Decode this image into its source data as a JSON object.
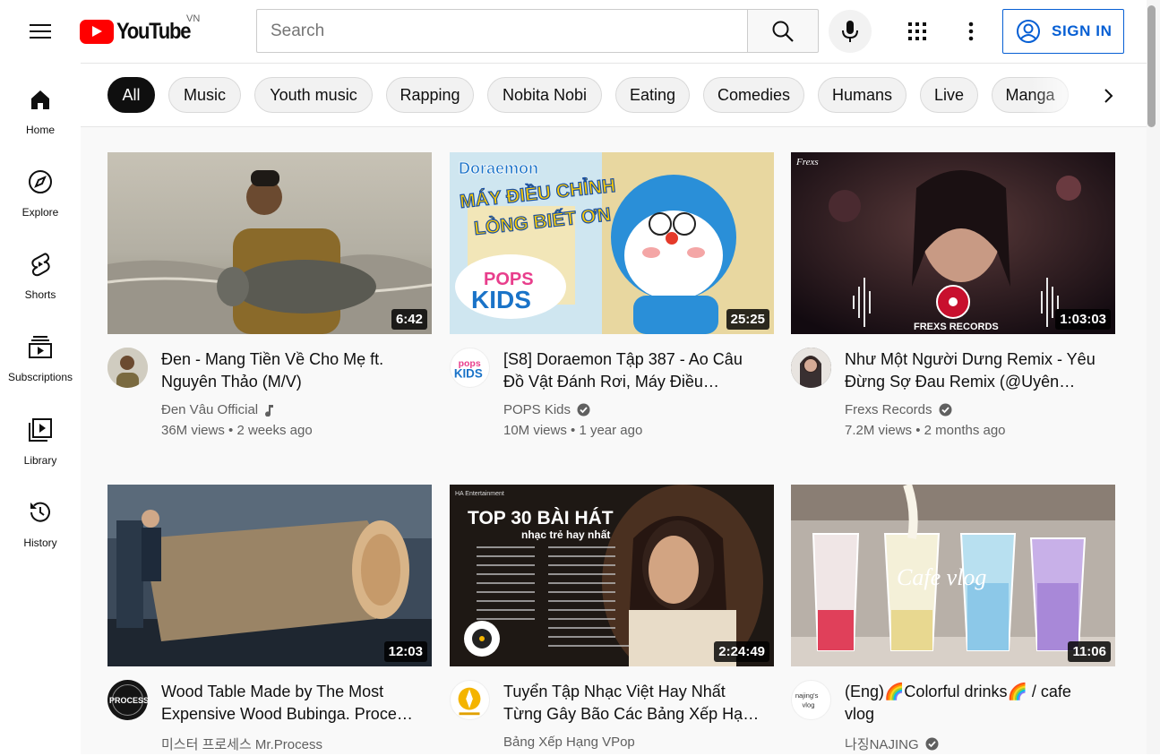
{
  "header": {
    "logo_text": "YouTube",
    "country_code": "VN",
    "search_placeholder": "Search",
    "sign_in_label": "SIGN IN",
    "accent_color": "#ff0000",
    "link_color": "#065fd4"
  },
  "sidebar": {
    "items": [
      {
        "label": "Home",
        "icon": "home-icon"
      },
      {
        "label": "Explore",
        "icon": "compass-icon"
      },
      {
        "label": "Shorts",
        "icon": "shorts-icon"
      },
      {
        "label": "Subscriptions",
        "icon": "subscriptions-icon"
      },
      {
        "label": "Library",
        "icon": "library-icon"
      },
      {
        "label": "History",
        "icon": "history-icon"
      }
    ]
  },
  "chips": [
    "All",
    "Music",
    "Youth music",
    "Rapping",
    "Nobita Nobi",
    "Eating",
    "Comedies",
    "Humans",
    "Live",
    "Manga"
  ],
  "videos": [
    {
      "title": "Đen - Mang Tiền Về Cho Mẹ ft. Nguyên Thảo (M/V)",
      "channel": "Đen Vâu Official",
      "badge": "music-note-icon",
      "views": "36M views",
      "age": "2 weeks ago",
      "duration": "6:42"
    },
    {
      "title": "[S8] Doraemon Tập 387 - Ao Câu Đồ Vật Đánh Rơi, Máy Điều Chỉnh…",
      "channel": "POPS Kids",
      "badge": "verified-icon",
      "views": "10M views",
      "age": "1 year ago",
      "duration": "25:25",
      "thumb_text_1": "Doraemon",
      "thumb_text_2": "MÁY ĐIỀU CHỈNH",
      "thumb_text_3": "LÒNG BIẾT ƠN",
      "thumb_text_4": "POPS",
      "thumb_text_5": "KIDS",
      "avatar_text_1": "pops",
      "avatar_text_2": "KIDS"
    },
    {
      "title": "Như Một Người Dưng Remix - Yêu Đừng Sợ Đau Remix (@Uyên…",
      "channel": "Frexs Records",
      "badge": "verified-icon",
      "views": "7.2M views",
      "age": "2 months ago",
      "duration": "1:03:03",
      "thumb_text_1": "FREXS RECORDS",
      "thumb_text_2": "Frexs"
    },
    {
      "title": "Wood Table Made by The Most Expensive Wood Bubinga. Proce…",
      "channel": "미스터 프로세스 Mr.Process",
      "badge": "",
      "views": "",
      "age": "",
      "duration": "12:03",
      "avatar_text_1": "PROCESS"
    },
    {
      "title": "Tuyển Tập Nhạc Việt Hay Nhất Từng Gây Bão Các Bảng Xếp Hạ…",
      "channel": "Bảng Xếp Hạng VPop",
      "badge": "",
      "views": "",
      "age": "",
      "duration": "2:24:49",
      "thumb_text_1": "TOP 30 BÀI HÁT",
      "thumb_text_2": "nhạc trẻ hay nhất",
      "thumb_text_3": "HA Entertainment"
    },
    {
      "title": "(Eng)🌈Colorful drinks🌈 / cafe vlog",
      "channel": "나징NAJING",
      "badge": "verified-icon",
      "views": "",
      "age": "",
      "duration": "11:06",
      "thumb_text_1": "Cafe vlog",
      "avatar_text_1": "najing's",
      "avatar_text_2": "vlog"
    }
  ]
}
